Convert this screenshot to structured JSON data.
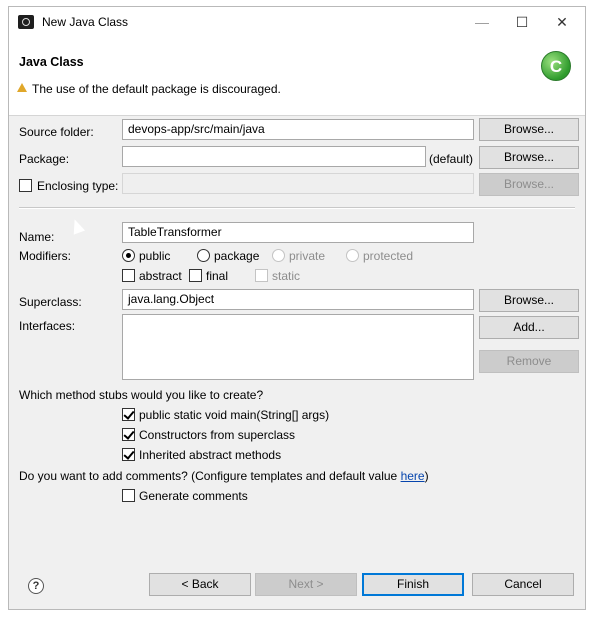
{
  "window": {
    "title": "New Java Class",
    "controls": {
      "minimize": "—",
      "maximize": "☐",
      "close": "✕"
    }
  },
  "header": {
    "title": "Java Class",
    "warning": "The use of the default package is discouraged.",
    "banner_icon_letter": "C"
  },
  "form": {
    "source_folder": {
      "label": "Source folder:",
      "value": "devops-app/src/main/java",
      "button": "Browse..."
    },
    "package": {
      "label": "Package:",
      "value": "",
      "suffix": "(default)",
      "button": "Browse..."
    },
    "enclosing": {
      "label": "Enclosing type:",
      "checked": false,
      "value": "",
      "button": "Browse..."
    },
    "name": {
      "label": "Name:",
      "value": "TableTransformer"
    },
    "modifiers": {
      "label": "Modifiers:",
      "access": [
        "public",
        "package",
        "private",
        "protected"
      ],
      "selected_access": "public",
      "abstract": "abstract",
      "final": "final",
      "static": "static"
    },
    "superclass": {
      "label": "Superclass:",
      "value": "java.lang.Object",
      "button": "Browse..."
    },
    "interfaces": {
      "label": "Interfaces:",
      "add_button": "Add...",
      "remove_button": "Remove"
    },
    "stubs": {
      "question": "Which method stubs would you like to create?",
      "main": "public static void main(String[] args)",
      "constructors": "Constructors from superclass",
      "inherited": "Inherited abstract methods"
    },
    "comments": {
      "question": "Do you want to add comments? (Configure templates and default value ",
      "link": "here",
      "question_end": ")",
      "generate": "Generate comments"
    }
  },
  "footer": {
    "help": "?",
    "back": "< Back",
    "next": "Next >",
    "finish": "Finish",
    "cancel": "Cancel"
  }
}
